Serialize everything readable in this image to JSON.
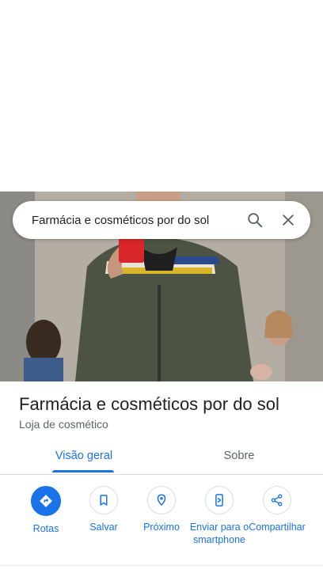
{
  "search": {
    "query": "Farmácia e cosméticos por do sol"
  },
  "place": {
    "name": "Farmácia e cosméticos por do sol",
    "category": "Loja de cosmético"
  },
  "tabs": [
    {
      "label": "Visão geral"
    },
    {
      "label": "Sobre"
    }
  ],
  "actions": [
    {
      "label": "Rotas",
      "icon": "directions-icon"
    },
    {
      "label": "Salvar",
      "icon": "bookmark-icon"
    },
    {
      "label": "Próximo",
      "icon": "nearby-icon"
    },
    {
      "label": "Enviar para o smartphone",
      "icon": "send-to-phone-icon"
    },
    {
      "label": "Compartilhar",
      "icon": "share-icon"
    }
  ],
  "colors": {
    "accent": "#1a73e8",
    "text": "#202124",
    "secondary": "#5f6368",
    "divider": "#dadce0"
  }
}
